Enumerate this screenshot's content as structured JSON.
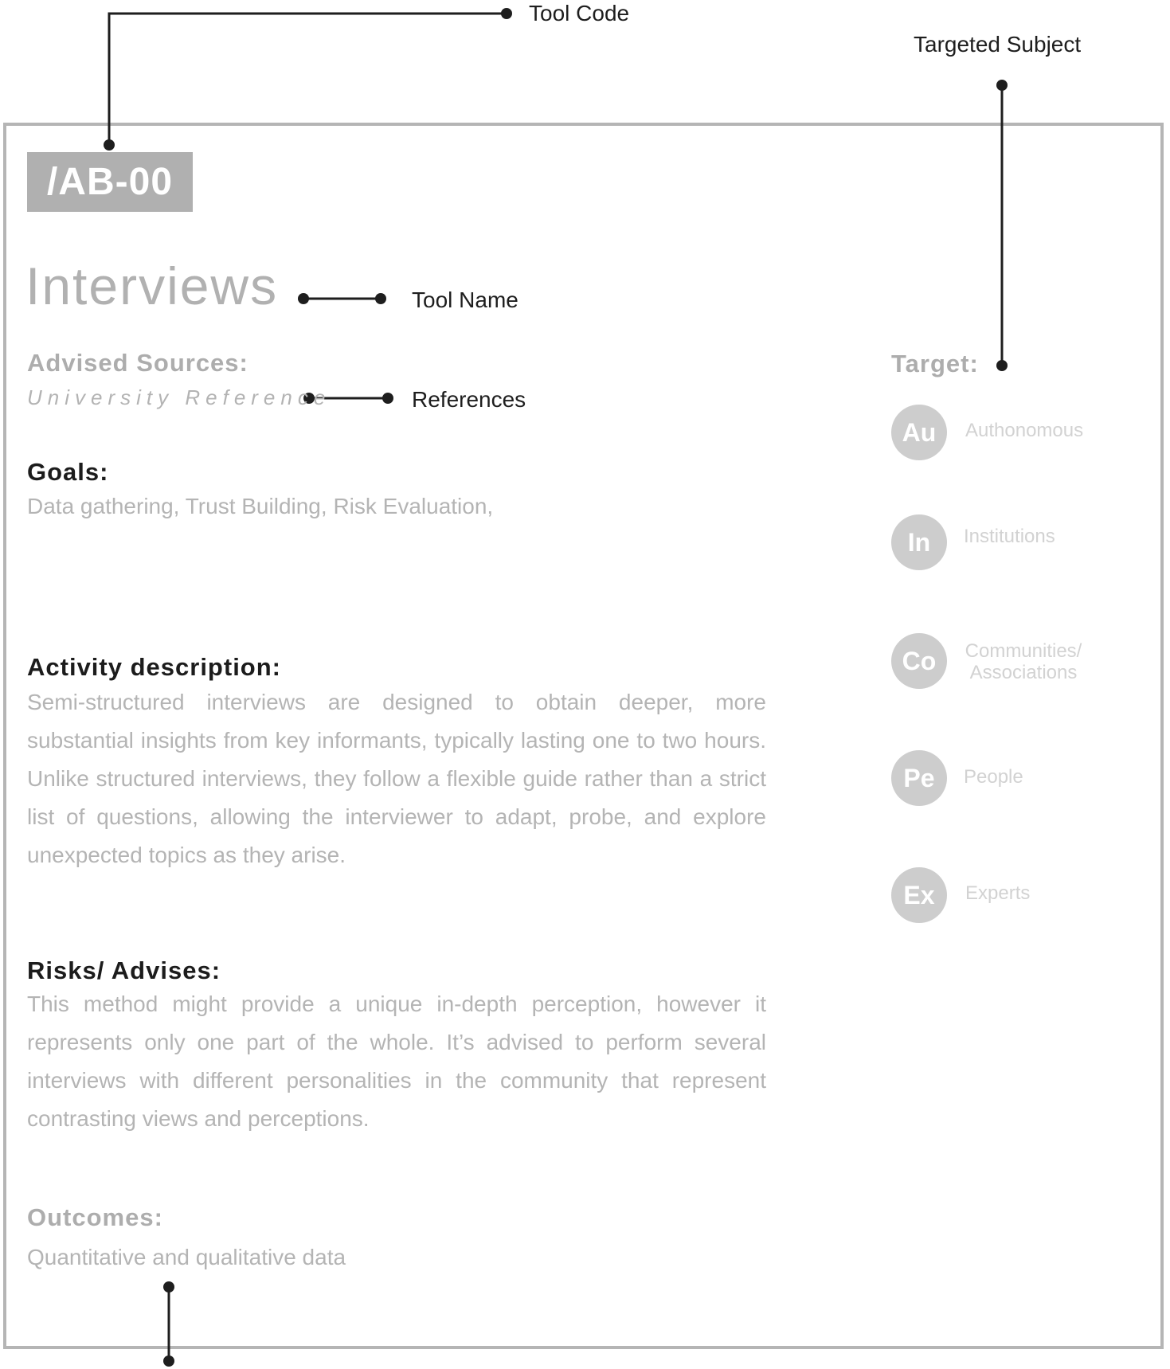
{
  "annotations": {
    "tool_code": "Tool Code",
    "targeted_subject": "Targeted Subject",
    "tool_name": "Tool Name",
    "references": "References"
  },
  "card": {
    "code": "/AB-00",
    "name": "Interviews",
    "advised_sources_label": "Advised Sources:",
    "reference": "University Reference",
    "goals_label": "Goals:",
    "goals": "Data gathering, Trust Building, Risk Evaluation,",
    "activity_label": "Activity description:",
    "activity": "Semi-structured interviews are designed to obtain deeper, more substantial insights from key informants, typically lasting one to two hours. Unlike structured interviews, they follow a flexible guide rather than a strict list of questions, allowing the interviewer to adapt, probe, and explore unexpected topics as they arise.",
    "risks_label": "Risks/ Advises:",
    "risks": "This method might provide a unique in-depth perception, however it represents only one part of the whole. It’s advised to perform several interviews with different personalities in the community that represent contrasting views and perceptions.",
    "outcomes_label": "Outcomes:",
    "outcomes": "Quantitative and qualitative data"
  },
  "target": {
    "label": "Target:",
    "items": [
      {
        "abbr": "Au",
        "name": "Authonomous"
      },
      {
        "abbr": "In",
        "name": "Institutions"
      },
      {
        "abbr": "Co",
        "name": "Communities/",
        "name2": "Associations"
      },
      {
        "abbr": "Pe",
        "name": "People"
      },
      {
        "abbr": "Ex",
        "name": "Experts"
      }
    ]
  },
  "colors": {
    "frame": "#b5b5b5",
    "badge": "#b0b0b0",
    "circle": "#cdcdcd",
    "leader": "#1e1e1e"
  }
}
